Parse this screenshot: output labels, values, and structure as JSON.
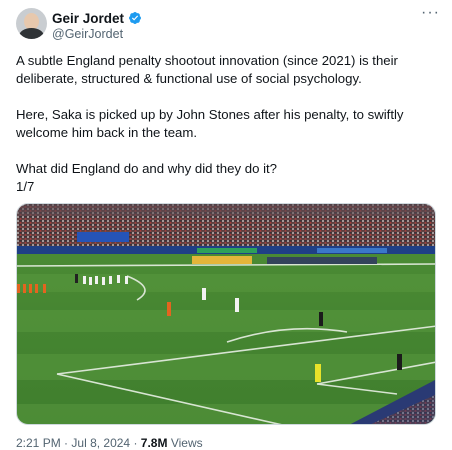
{
  "author": {
    "display_name": "Geir Jordet",
    "handle": "@GeirJordet",
    "verified_icon": "verified-badge-icon",
    "badge_color": "#1d9bf0"
  },
  "more_label": "···",
  "tweet": {
    "paragraphs": [
      "A subtle England penalty shootout innovation (since 2021) is their deliberate, structured & functional use of social psychology.",
      "Here, Saka is picked up by John Stones after his penalty, to swiftly welcome him back in the team.",
      "What did England do and why did they do it?",
      "1/7"
    ]
  },
  "media": {
    "type": "image",
    "subject": "football-stadium-penalty-shootout"
  },
  "meta": {
    "time": "2:21 PM",
    "separator": "·",
    "date": "Jul 8, 2024",
    "views_count": "7.8M",
    "views_label": "Views"
  }
}
